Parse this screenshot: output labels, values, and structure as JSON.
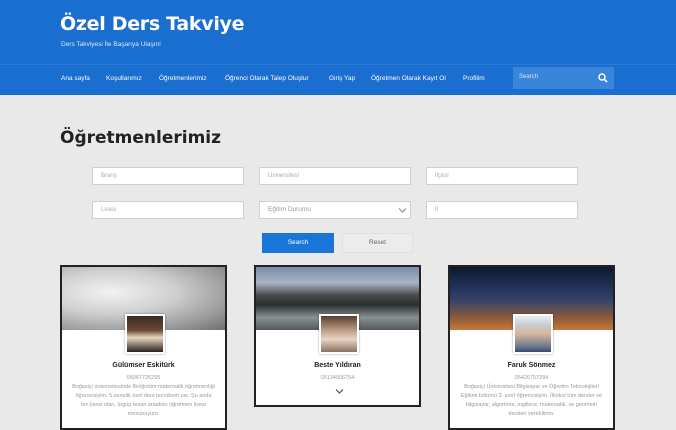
{
  "header": {
    "site_title": "Özel Ders Takviye",
    "tagline": "Ders Takviyesi İle Başarıya Ulaşın!",
    "nav": [
      "Ana sayfa",
      "Koşullarımız",
      "Öğretmenlerimiz",
      "Öğrenci Olarak Talep Oluştur",
      "Giriş Yap",
      "Öğretmen Olarak Kayıt Ol",
      "Profilim"
    ],
    "search_placeholder": "Search"
  },
  "page": {
    "title": "Öğretmenlerimiz"
  },
  "filters": {
    "brans": "Branş",
    "universite": "Üniversitesi",
    "ilce": "İlçesi",
    "lise": "Lisesi",
    "egitim_durumu": "Eğitim Durumu",
    "il": "İl",
    "search_label": "Search",
    "reset_label": "Reset"
  },
  "teachers": [
    {
      "name": "Gülümser Eskitürk",
      "phone": "05067726255",
      "bio": "Boğaziçi üniversitesinde İlköğretim matematik öğretmenliği öğrencisiyim. 5 senelik özel ders tecrübem var. Şu anda fen lisesi olan, ürgüp tesan anadolu öğretmen lisesi mezunuyum."
    },
    {
      "name": "Beste Yıldıran",
      "phone": "05134506754",
      "bio": ""
    },
    {
      "name": "Faruk Sönmez",
      "phone": "05426757294",
      "bio": "Boğaziçi Üniversitesi Bilgisayar ve Öğretim Teknolojileri Eğitimi bölümü 3. sınıf öğrencisiyim. İlkokul tüm dersler ve bilgisayar, algoritma, ingilizce, matematik, ve geometri dersleri verebilirim."
    }
  ],
  "icons": {
    "search": "search-icon",
    "dropdown": "chevron-down-icon",
    "expand": "chevron-down-icon"
  },
  "colors": {
    "header": "#1a6ed0",
    "accent": "#1a75d8"
  }
}
